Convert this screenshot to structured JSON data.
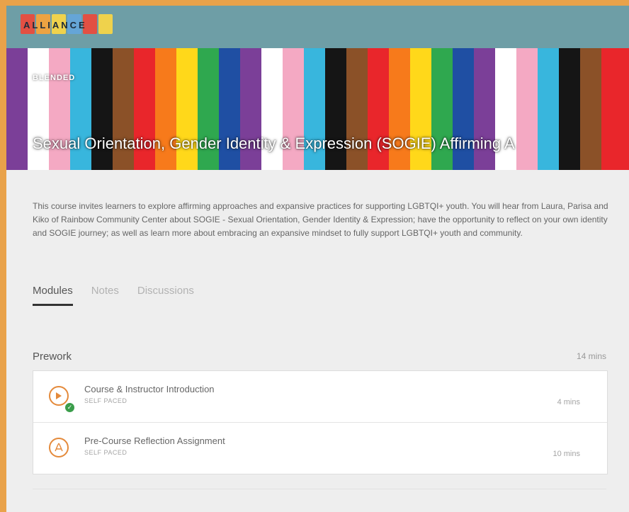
{
  "header": {
    "logo_text": "ALLIANCE",
    "logo_sub": "",
    "logo_colors": [
      "#e84c3d",
      "#f3a33c",
      "#f5d547",
      "#64a5d9",
      "#e84c3d",
      "#f5d547"
    ]
  },
  "hero": {
    "tag": "BLENDED",
    "title": "Sexual Orientation, Gender Identity & Expression (SOGIE) Affirming A",
    "stripes": [
      "#7b3f98",
      "#ffffff",
      "#f4a9c3",
      "#38b6dd",
      "#151515",
      "#8b5128",
      "#e9262b",
      "#f77a1b",
      "#ffd81a",
      "#2fa84f",
      "#1f4fa3",
      "#7b3f98",
      "#ffffff",
      "#f4a9c3",
      "#38b6dd",
      "#151515",
      "#8b5128",
      "#e9262b",
      "#f77a1b",
      "#ffd81a",
      "#2fa84f",
      "#1f4fa3",
      "#7b3f98",
      "#ffffff",
      "#f4a9c3",
      "#38b6dd",
      "#151515",
      "#8b5128",
      "#e9262b",
      "#e9262b"
    ]
  },
  "description": "This course invites learners to explore affirming approaches and expansive practices for supporting LGBTQI+ youth. You will hear from Laura, Parisa and Kiko of Rainbow Community Center about SOGIE - Sexual Orientation, Gender Identity & Expression; have the opportunity to reflect on your own identity and SOGIE journey; as well as learn more about embracing an expansive mindset to fully support LGBTQI+ youth and community.",
  "tabs": [
    {
      "label": "Modules",
      "active": true
    },
    {
      "label": "Notes",
      "active": false
    },
    {
      "label": "Discussions",
      "active": false
    }
  ],
  "section": {
    "title": "Prework",
    "time": "14 mins",
    "items": [
      {
        "title": "Course & Instructor Introduction",
        "sub": "SELF PACED",
        "time": "4 mins",
        "icon": "play-icon",
        "completed": true
      },
      {
        "title": "Pre-Course Reflection Assignment",
        "sub": "SELF PACED",
        "time": "10 mins",
        "icon": "pdf-icon",
        "completed": false
      }
    ]
  },
  "colors": {
    "accent": "#e48a3b",
    "topbar": "#6e9ea6",
    "complete": "#3a9d4a"
  }
}
